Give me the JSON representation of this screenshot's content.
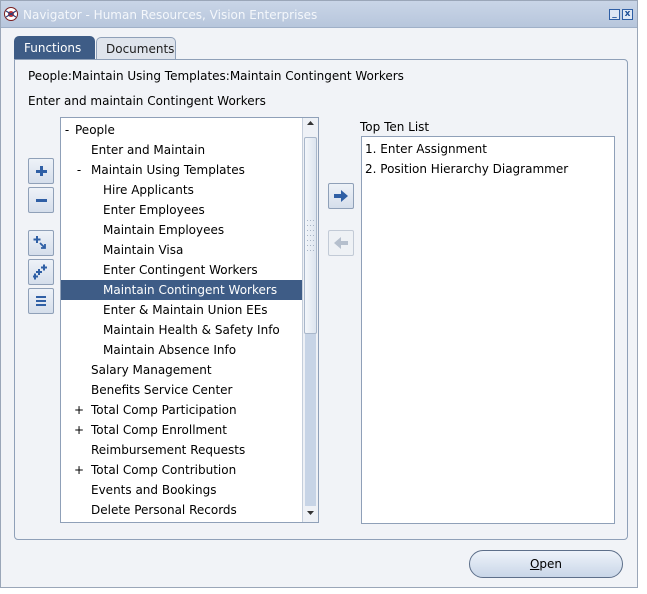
{
  "window": {
    "title": "Navigator - Human Resources, Vision Enterprises",
    "minimize_glyph": "_",
    "close_glyph": "x"
  },
  "tabs": [
    {
      "label": "Functions",
      "active": true
    },
    {
      "label": "Documents",
      "active": false
    }
  ],
  "path": "People:Maintain Using Templates:Maintain Contingent Workers",
  "description": "Enter and maintain Contingent Workers",
  "side_buttons": [
    {
      "name": "expand-button",
      "icon": "plus-icon"
    },
    {
      "name": "collapse-button",
      "icon": "minus-icon"
    },
    {
      "name": "expand-branch-button",
      "icon": "expand-branch-icon"
    },
    {
      "name": "expand-all-button",
      "icon": "expand-all-icon"
    },
    {
      "name": "collapse-all-button",
      "icon": "collapse-all-icon"
    }
  ],
  "tree": {
    "items": [
      {
        "mark": "-",
        "label": "People",
        "level": 0
      },
      {
        "mark": "",
        "label": "Enter and Maintain",
        "level": 1
      },
      {
        "mark": "-",
        "label": "Maintain Using Templates",
        "level": 1
      },
      {
        "mark": "",
        "label": "Hire Applicants",
        "level": 2
      },
      {
        "mark": "",
        "label": "Enter Employees",
        "level": 2
      },
      {
        "mark": "",
        "label": "Maintain Employees",
        "level": 2
      },
      {
        "mark": "",
        "label": "Maintain Visa",
        "level": 2
      },
      {
        "mark": "",
        "label": "Enter Contingent Workers",
        "level": 2
      },
      {
        "mark": "",
        "label": "Maintain Contingent Workers",
        "level": 2,
        "selected": true
      },
      {
        "mark": "",
        "label": "Enter & Maintain Union EEs",
        "level": 2
      },
      {
        "mark": "",
        "label": "Maintain Health & Safety Info",
        "level": 2
      },
      {
        "mark": "",
        "label": "Maintain Absence Info",
        "level": 2
      },
      {
        "mark": "",
        "label": "Salary Management",
        "level": 1
      },
      {
        "mark": "",
        "label": "Benefits Service Center",
        "level": 1
      },
      {
        "mark": "+",
        "label": "Total Comp Participation",
        "level": 1
      },
      {
        "mark": "+",
        "label": "Total Comp Enrollment",
        "level": 1
      },
      {
        "mark": "",
        "label": "Reimbursement Requests",
        "level": 1
      },
      {
        "mark": "+",
        "label": "Total Comp Contribution",
        "level": 1
      },
      {
        "mark": "",
        "label": "Events and Bookings",
        "level": 1
      },
      {
        "mark": "",
        "label": "Delete Personal Records",
        "level": 1
      }
    ]
  },
  "top_ten": {
    "label": "Top Ten List",
    "items": [
      "1. Enter Assignment",
      "2. Position Hierarchy Diagrammer"
    ]
  },
  "buttons": {
    "open_mnemonic": "O",
    "open_rest": "pen"
  },
  "colors": {
    "selection": "#3e5c86",
    "accent_blue": "#2f5fa5",
    "arrow_disabled": "#b5bfcd"
  }
}
